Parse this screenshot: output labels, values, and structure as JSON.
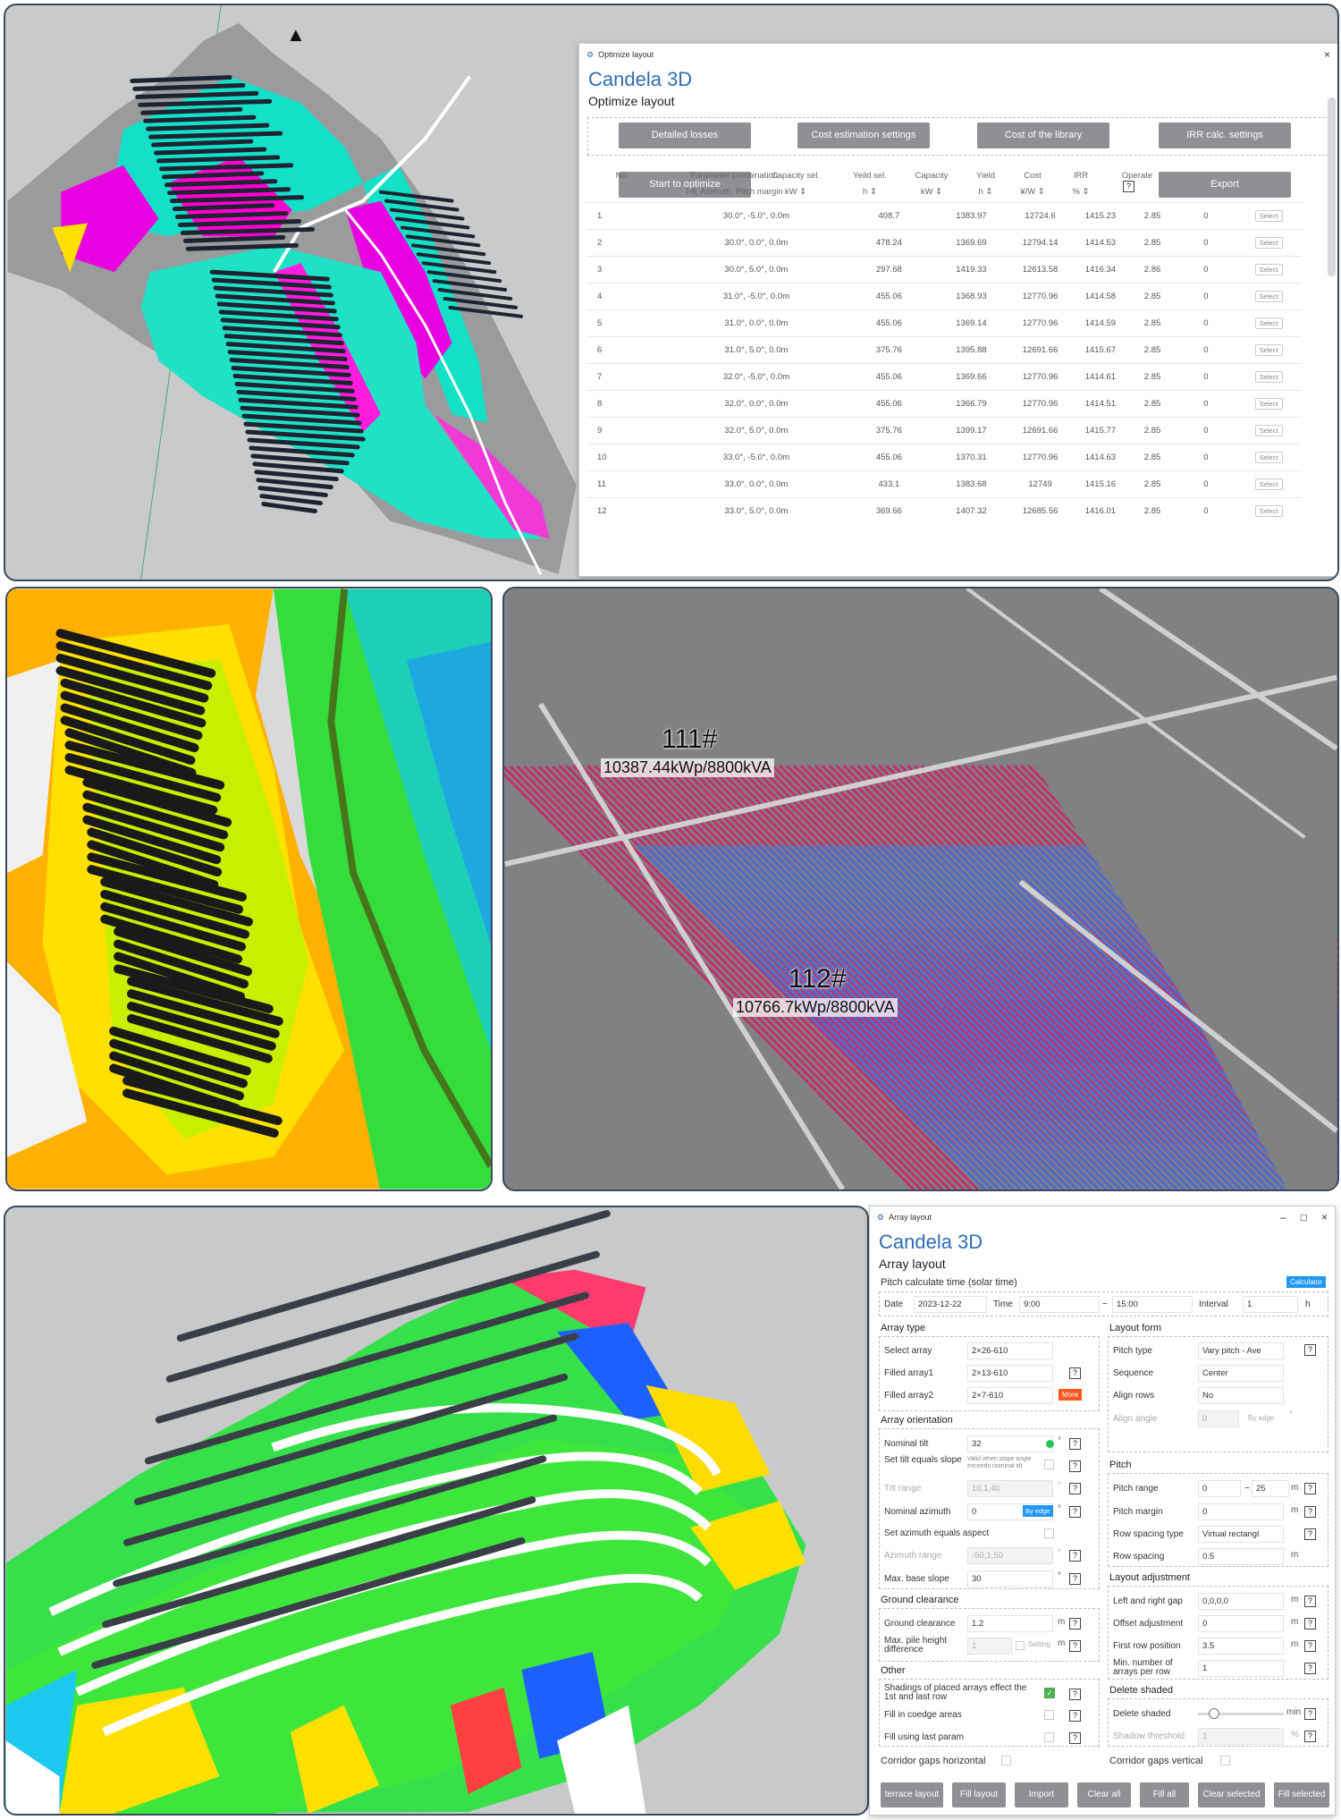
{
  "optimize_window": {
    "title": "Optimize layout",
    "brand": "Candela 3D",
    "subtitle": "Optimize layout",
    "close": "×",
    "buttons": [
      "Detailed losses",
      "Cost estimation settings",
      "Cost of the library",
      "IRR calc. settings"
    ],
    "start_button": "Start to optimize",
    "export_button": "Export",
    "help": "?",
    "columns": [
      {
        "top": "No.",
        "bottom": ""
      },
      {
        "top": "Parameter combination",
        "bottom": "Tilt, Azimuth, Pitch margin"
      },
      {
        "top": "Capacity sel.",
        "bottom": "kW"
      },
      {
        "top": "Yeild sel.",
        "bottom": "h"
      },
      {
        "top": "Capacity",
        "bottom": "kW"
      },
      {
        "top": "Yield",
        "bottom": "h"
      },
      {
        "top": "Cost",
        "bottom": "¥/W"
      },
      {
        "top": "IRR",
        "bottom": "%"
      },
      {
        "top": "Operate",
        "bottom": ""
      }
    ],
    "rows": [
      [
        "1",
        "30.0°, -5.0°, 0.0m",
        "408.7",
        "1383.97",
        "12724.6",
        "1415.23",
        "2.85",
        "0"
      ],
      [
        "2",
        "30.0°, 0.0°, 0.0m",
        "478.24",
        "1369.69",
        "12794.14",
        "1414.53",
        "2.85",
        "0"
      ],
      [
        "3",
        "30.0°, 5.0°, 0.0m",
        "297.68",
        "1419.33",
        "12613.58",
        "1416.34",
        "2.86",
        "0"
      ],
      [
        "4",
        "31.0°, -5.0°, 0.0m",
        "455.06",
        "1368.93",
        "12770.96",
        "1414.58",
        "2.85",
        "0"
      ],
      [
        "5",
        "31.0°, 0.0°, 0.0m",
        "455.06",
        "1369.14",
        "12770.96",
        "1414.59",
        "2.85",
        "0"
      ],
      [
        "6",
        "31.0°, 5.0°, 0.0m",
        "375.76",
        "1395.88",
        "12691.66",
        "1415.67",
        "2.85",
        "0"
      ],
      [
        "7",
        "32.0°, -5.0°, 0.0m",
        "455.06",
        "1369.66",
        "12770.96",
        "1414.61",
        "2.85",
        "0"
      ],
      [
        "8",
        "32.0°, 0.0°, 0.0m",
        "455.06",
        "1366.79",
        "12770.96",
        "1414.51",
        "2.85",
        "0"
      ],
      [
        "9",
        "32.0°, 5.0°, 0.0m",
        "375.76",
        "1399.17",
        "12691.66",
        "1415.77",
        "2.85",
        "0"
      ],
      [
        "10",
        "33.0°, -5.0°, 0.0m",
        "455.06",
        "1370.31",
        "12770.96",
        "1414.63",
        "2.85",
        "0"
      ],
      [
        "11",
        "33.0°, 0.0°, 0.0m",
        "433.1",
        "1383.68",
        "12749",
        "1415.16",
        "2.85",
        "0"
      ],
      [
        "12",
        "33.0°, 5.0°, 0.0m",
        "369.66",
        "1407.32",
        "12685.56",
        "1416.01",
        "2.85",
        "0"
      ]
    ],
    "select_label": "Select"
  },
  "viewport_labels": {
    "block1_id": "111#",
    "block1_cap": "10387.44kWp/8800kVA",
    "block2_id": "112#",
    "block2_cap": "10766.7kWp/8800kVA"
  },
  "array_window": {
    "title": "Array layout",
    "brand": "Candela 3D",
    "subtitle": "Array layout",
    "controls": [
      "–",
      "□",
      "×"
    ],
    "pitch_time_label": "Pitch calculate time (solar time)",
    "calculator": "Calculator",
    "date_label": "Date",
    "date": "2023-12-22",
    "time_label": "Time",
    "time_from": "9:00",
    "tilde": "~",
    "time_to": "15:00",
    "interval_label": "Interval",
    "interval": "1",
    "interval_unit": "h",
    "array_type": {
      "title": "Array type",
      "select_array_label": "Select array",
      "select_array": "2×26-610",
      "filled1_label": "Filled array1",
      "filled1": "2×13-610",
      "filled2_label": "Filled array2",
      "filled2": "2×7-610",
      "more": "More"
    },
    "orientation": {
      "title": "Array orientation",
      "nominal_tilt_label": "Nominal tilt",
      "nominal_tilt": "32",
      "tilt_slope_label": "Set tilt equals slope",
      "tilt_slope_note": "Valid when slope angle exceeds nominal tilt",
      "tilt_range_label": "Tilt range",
      "tilt_range": "10,1,40",
      "nominal_azimuth_label": "Nominal azimuth",
      "nominal_azimuth": "0",
      "by_edge": "By edge",
      "azimuth_aspect_label": "Set azimuth equals aspect",
      "azimuth_range_label": "Azimuth range",
      "azimuth_range": "-50,1,50",
      "max_slope_label": "Max. base slope",
      "max_slope": "30"
    },
    "ground": {
      "title": "Ground clearance",
      "clearance_label": "Ground clearance",
      "clearance": "1.2",
      "pile_label": "Max. pile height difference",
      "pile": "1",
      "setting": "Setting"
    },
    "other": {
      "title": "Other",
      "shading_label": "Shadings of placed arrays effect the 1st and last row",
      "coedge_label": "Fill in coedge areas",
      "last_param_label": "Fill using last param"
    },
    "corridor_h": "Corridor gaps horizontal",
    "corridor_v": "Corridor gaps vertical",
    "layout_form": {
      "title": "Layout form",
      "pitch_type_label": "Pitch type",
      "pitch_type": "Vary pitch - Ave",
      "sequence_label": "Sequence",
      "sequence": "Center",
      "align_rows_label": "Align rows",
      "align_rows": "No",
      "align_angle_label": "Align angle",
      "align_angle": "0",
      "by_edge": "By edge"
    },
    "pitch": {
      "title": "Pitch",
      "range_label": "Pitch range",
      "range_from": "0",
      "range_to": "25",
      "margin_label": "Pitch margin",
      "margin": "0",
      "row_type_label": "Row spacing type",
      "row_type": "Virtual rectangl",
      "row_spacing_label": "Row spacing",
      "row_spacing": "0.5"
    },
    "adjust": {
      "title": "Layout adjustment",
      "lr_gap_label": "Left and right gap",
      "lr_gap": "0,0,0,0",
      "offset_label": "Offset adjustment",
      "offset": "0",
      "first_row_label": "First row position",
      "first_row": "3.5",
      "min_arrays_label": "Min. number of arrays per row",
      "min_arrays": "1"
    },
    "delete": {
      "title": "Delete shaded",
      "delete_label": "Delete shaded",
      "delete_unit": "min",
      "threshold_label": "Shadow threshold",
      "threshold": "1",
      "threshold_unit": "%"
    },
    "unit_m": "m",
    "unit_deg": "°",
    "help": "?",
    "bottom_buttons": [
      "terrace layout",
      "Fill layout",
      "Import",
      "Clear all",
      "Fill all",
      "Clear selected",
      "Fill selected"
    ]
  }
}
